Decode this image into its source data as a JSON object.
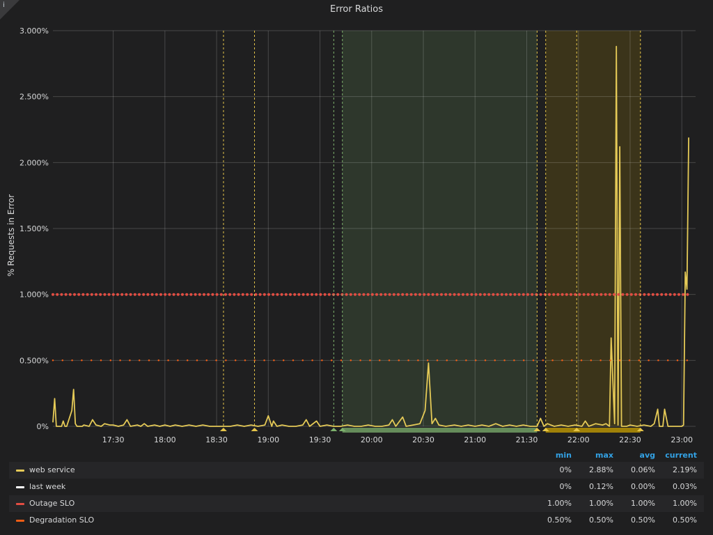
{
  "panel": {
    "info_glyph": "i"
  },
  "chart_data": {
    "type": "line",
    "title": "Error Ratios",
    "ylabel": "% Requests in Error",
    "ylim": [
      0,
      3.0
    ],
    "y_ticks": [
      {
        "v": 0,
        "label": "0%"
      },
      {
        "v": 0.5,
        "label": "0.500%"
      },
      {
        "v": 1.0,
        "label": "1.000%"
      },
      {
        "v": 1.5,
        "label": "1.500%"
      },
      {
        "v": 2.0,
        "label": "2.000%"
      },
      {
        "v": 2.5,
        "label": "2.500%"
      },
      {
        "v": 3.0,
        "label": "3.000%"
      }
    ],
    "xlim": [
      "16:55",
      "23:08"
    ],
    "x_ticks": [
      "17:30",
      "18:00",
      "18:30",
      "19:00",
      "19:30",
      "20:00",
      "20:30",
      "21:00",
      "21:30",
      "22:00",
      "22:30",
      "23:00"
    ],
    "grid": true,
    "legend_placement": "bottom",
    "legend_columns": [
      "min",
      "max",
      "avg",
      "current"
    ],
    "regions": [
      {
        "start": "19:43",
        "end": "21:36",
        "color": "#7eb26d"
      },
      {
        "start": "21:41",
        "end": "22:36",
        "color": "#cca300"
      }
    ],
    "annotations": [
      {
        "time": "18:34",
        "color": "#e5c54a"
      },
      {
        "time": "18:52",
        "color": "#e5c54a"
      },
      {
        "time": "19:38",
        "color": "#7eb26d"
      },
      {
        "time": "19:43",
        "color": "#7eb26d"
      },
      {
        "time": "21:36",
        "color": "#e5c54a"
      },
      {
        "time": "21:41",
        "color": "#e5c54a"
      },
      {
        "time": "21:59",
        "color": "#e5c54a"
      },
      {
        "time": "22:36",
        "color": "#e5c54a"
      }
    ],
    "series": [
      {
        "name": "web service",
        "color": "#e5ca57",
        "style": "solid",
        "min": "0%",
        "max": "2.88%",
        "avg": "0.06%",
        "current": "2.19%",
        "points": [
          [
            "16:55",
            0.03
          ],
          [
            "16:56",
            0.21
          ],
          [
            "16:57",
            0.0
          ],
          [
            "17:00",
            0.0
          ],
          [
            "17:01",
            0.04
          ],
          [
            "17:02",
            0.0
          ],
          [
            "17:03",
            0.0
          ],
          [
            "17:06",
            0.12
          ],
          [
            "17:07",
            0.28
          ],
          [
            "17:08",
            0.02
          ],
          [
            "17:09",
            0.0
          ],
          [
            "17:12",
            0.0
          ],
          [
            "17:13",
            0.01
          ],
          [
            "17:16",
            0.0
          ],
          [
            "17:18",
            0.05
          ],
          [
            "17:20",
            0.01
          ],
          [
            "17:23",
            0.0
          ],
          [
            "17:25",
            0.02
          ],
          [
            "17:28",
            0.01
          ],
          [
            "17:30",
            0.01
          ],
          [
            "17:33",
            0.0
          ],
          [
            "17:36",
            0.01
          ],
          [
            "17:38",
            0.05
          ],
          [
            "17:40",
            0.0
          ],
          [
            "17:44",
            0.01
          ],
          [
            "17:46",
            0.0
          ],
          [
            "17:48",
            0.02
          ],
          [
            "17:50",
            0.0
          ],
          [
            "17:54",
            0.01
          ],
          [
            "17:57",
            0.0
          ],
          [
            "18:00",
            0.01
          ],
          [
            "18:03",
            0.0
          ],
          [
            "18:06",
            0.01
          ],
          [
            "18:10",
            0.0
          ],
          [
            "18:14",
            0.01
          ],
          [
            "18:18",
            0.0
          ],
          [
            "18:22",
            0.01
          ],
          [
            "18:26",
            0.0
          ],
          [
            "18:30",
            0.0
          ],
          [
            "18:34",
            0.0
          ],
          [
            "18:38",
            0.0
          ],
          [
            "18:42",
            0.01
          ],
          [
            "18:46",
            0.0
          ],
          [
            "18:50",
            0.01
          ],
          [
            "18:54",
            0.0
          ],
          [
            "18:58",
            0.01
          ],
          [
            "19:00",
            0.08
          ],
          [
            "19:02",
            0.0
          ],
          [
            "19:03",
            0.04
          ],
          [
            "19:05",
            0.0
          ],
          [
            "19:08",
            0.01
          ],
          [
            "19:12",
            0.0
          ],
          [
            "19:16",
            0.0
          ],
          [
            "19:20",
            0.01
          ],
          [
            "19:22",
            0.05
          ],
          [
            "19:24",
            0.0
          ],
          [
            "19:28",
            0.04
          ],
          [
            "19:30",
            0.0
          ],
          [
            "19:34",
            0.01
          ],
          [
            "19:38",
            0.0
          ],
          [
            "19:42",
            0.0
          ],
          [
            "19:46",
            0.01
          ],
          [
            "19:50",
            0.0
          ],
          [
            "19:54",
            0.0
          ],
          [
            "19:58",
            0.01
          ],
          [
            "20:02",
            0.0
          ],
          [
            "20:06",
            0.0
          ],
          [
            "20:10",
            0.01
          ],
          [
            "20:12",
            0.05
          ],
          [
            "20:14",
            0.0
          ],
          [
            "20:18",
            0.07
          ],
          [
            "20:20",
            0.0
          ],
          [
            "20:24",
            0.01
          ],
          [
            "20:28",
            0.02
          ],
          [
            "20:31",
            0.12
          ],
          [
            "20:33",
            0.48
          ],
          [
            "20:35",
            0.02
          ],
          [
            "20:37",
            0.06
          ],
          [
            "20:39",
            0.01
          ],
          [
            "20:43",
            0.0
          ],
          [
            "20:48",
            0.01
          ],
          [
            "20:52",
            0.0
          ],
          [
            "20:56",
            0.01
          ],
          [
            "21:00",
            0.0
          ],
          [
            "21:04",
            0.01
          ],
          [
            "21:08",
            0.0
          ],
          [
            "21:12",
            0.02
          ],
          [
            "21:16",
            0.0
          ],
          [
            "21:20",
            0.01
          ],
          [
            "21:24",
            0.0
          ],
          [
            "21:28",
            0.01
          ],
          [
            "21:32",
            0.0
          ],
          [
            "21:36",
            0.0
          ],
          [
            "21:38",
            0.06
          ],
          [
            "21:40",
            0.0
          ],
          [
            "21:42",
            0.02
          ],
          [
            "21:46",
            0.0
          ],
          [
            "21:50",
            0.01
          ],
          [
            "21:54",
            0.0
          ],
          [
            "21:58",
            0.01
          ],
          [
            "22:02",
            0.0
          ],
          [
            "22:04",
            0.04
          ],
          [
            "22:06",
            0.0
          ],
          [
            "22:10",
            0.02
          ],
          [
            "22:14",
            0.01
          ],
          [
            "22:16",
            0.02
          ],
          [
            "22:18",
            0.0
          ],
          [
            "22:19",
            0.67
          ],
          [
            "22:21",
            0.02
          ],
          [
            "22:22",
            2.88
          ],
          [
            "22:23",
            0.01
          ],
          [
            "22:24",
            2.12
          ],
          [
            "22:25",
            0.0
          ],
          [
            "22:28",
            0.0
          ],
          [
            "22:30",
            0.01
          ],
          [
            "22:34",
            0.0
          ],
          [
            "22:38",
            0.01
          ],
          [
            "22:42",
            0.0
          ],
          [
            "22:44",
            0.02
          ],
          [
            "22:46",
            0.13
          ],
          [
            "22:47",
            0.0
          ],
          [
            "22:49",
            0.0
          ],
          [
            "22:50",
            0.13
          ],
          [
            "22:52",
            0.0
          ],
          [
            "22:55",
            0.0
          ],
          [
            "22:58",
            0.0
          ],
          [
            "23:00",
            0.0
          ],
          [
            "23:01",
            0.01
          ],
          [
            "23:02",
            1.17
          ],
          [
            "23:03",
            1.04
          ],
          [
            "23:04",
            2.19
          ]
        ]
      },
      {
        "name": "last week",
        "color": "#ffffff",
        "style": "solid",
        "min": "0%",
        "max": "0.12%",
        "avg": "0.00%",
        "current": "0.03%",
        "points": []
      },
      {
        "name": "Outage SLO",
        "color": "#e24d42",
        "style": "dotted",
        "min": "1.00%",
        "max": "1.00%",
        "avg": "1.00%",
        "current": "1.00%",
        "points": [
          [
            "16:55",
            1.0
          ],
          [
            "23:04",
            1.0
          ]
        ]
      },
      {
        "name": "Degradation SLO",
        "color": "#ef5d15",
        "style": "dotted",
        "min": "0.50%",
        "max": "0.50%",
        "avg": "0.50%",
        "current": "0.50%",
        "points": [
          [
            "16:55",
            0.5
          ],
          [
            "23:04",
            0.5
          ]
        ]
      }
    ]
  }
}
